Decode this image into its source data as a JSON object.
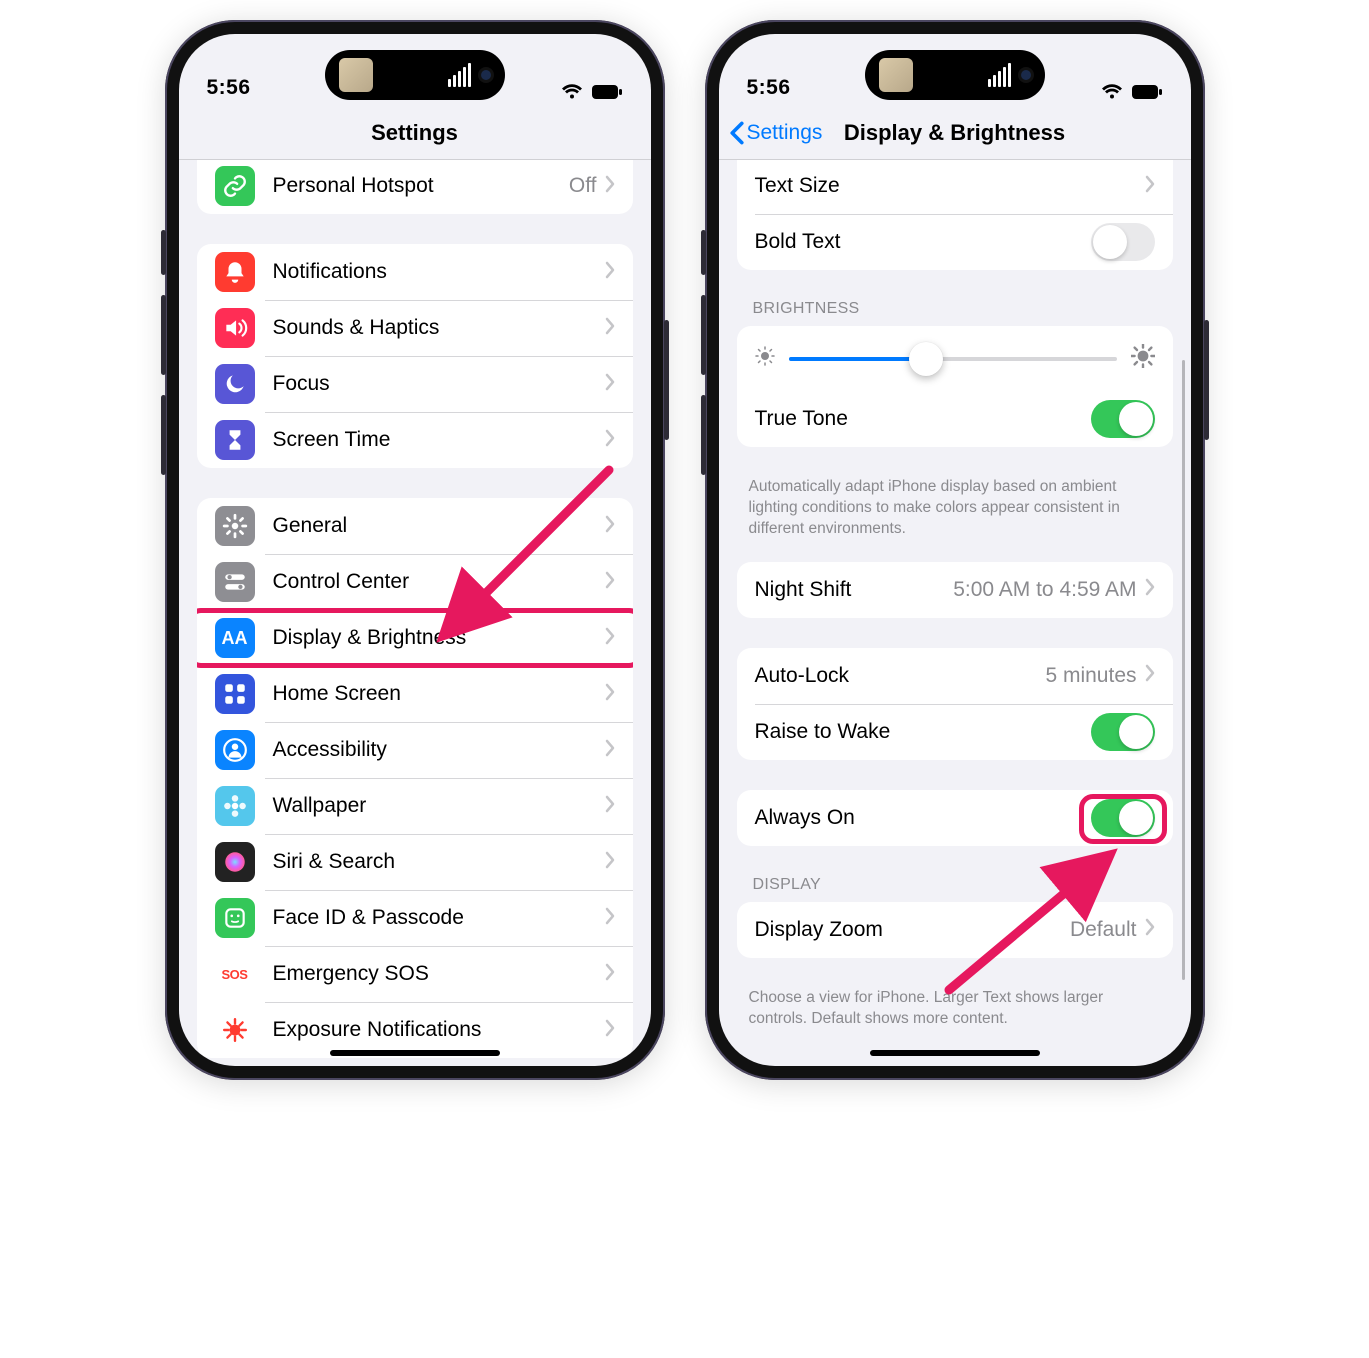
{
  "status": {
    "time": "5:56"
  },
  "phone1": {
    "title": "Settings",
    "group0": [
      {
        "id": "hotspot",
        "label": "Personal Hotspot",
        "detail": "Off",
        "color": "#34c759",
        "icon": "link"
      }
    ],
    "group1": [
      {
        "id": "notifications",
        "label": "Notifications",
        "color": "#ff3b30",
        "icon": "bell"
      },
      {
        "id": "sounds",
        "label": "Sounds & Haptics",
        "color": "#ff2d55",
        "icon": "speaker"
      },
      {
        "id": "focus",
        "label": "Focus",
        "color": "#5856d6",
        "icon": "moon"
      },
      {
        "id": "screentime",
        "label": "Screen Time",
        "color": "#5856d6",
        "icon": "hourglass"
      }
    ],
    "group2": [
      {
        "id": "general",
        "label": "General",
        "color": "#8e8e93",
        "icon": "gear"
      },
      {
        "id": "controlcenter",
        "label": "Control Center",
        "color": "#8e8e93",
        "icon": "switches"
      },
      {
        "id": "display",
        "label": "Display & Brightness",
        "color": "#0a84ff",
        "icon": "AA",
        "highlight": true
      },
      {
        "id": "homescreen",
        "label": "Home Screen",
        "color": "#3355dd",
        "icon": "grid"
      },
      {
        "id": "accessibility",
        "label": "Accessibility",
        "color": "#0a84ff",
        "icon": "person"
      },
      {
        "id": "wallpaper",
        "label": "Wallpaper",
        "color": "#54c7ec",
        "icon": "flower"
      },
      {
        "id": "siri",
        "label": "Siri & Search",
        "color": "#222",
        "icon": "siri"
      },
      {
        "id": "faceid",
        "label": "Face ID & Passcode",
        "color": "#34c759",
        "icon": "face"
      },
      {
        "id": "sos",
        "label": "Emergency SOS",
        "color": "#fff",
        "icon": "SOS",
        "textColor": "#ff3b30"
      },
      {
        "id": "exposure",
        "label": "Exposure Notifications",
        "color": "#fff",
        "icon": "covid",
        "textColor": "#ff3b30"
      }
    ]
  },
  "phone2": {
    "back": "Settings",
    "title": "Display & Brightness",
    "text_section": {
      "text_size": "Text Size",
      "bold_text": "Bold Text",
      "bold_text_on": false
    },
    "brightness_header": "BRIGHTNESS",
    "brightness_pct": 42,
    "true_tone": {
      "label": "True Tone",
      "on": true
    },
    "true_tone_footer": "Automatically adapt iPhone display based on ambient lighting conditions to make colors appear consistent in different environments.",
    "night_shift": {
      "label": "Night Shift",
      "detail": "5:00 AM to 4:59 AM"
    },
    "auto_lock": {
      "label": "Auto-Lock",
      "detail": "5 minutes"
    },
    "raise_to_wake": {
      "label": "Raise to Wake",
      "on": true
    },
    "always_on": {
      "label": "Always On",
      "on": true,
      "highlight": true
    },
    "display_header": "DISPLAY",
    "display_zoom": {
      "label": "Display Zoom",
      "detail": "Default"
    },
    "display_footer": "Choose a view for iPhone. Larger Text shows larger controls. Default shows more content."
  }
}
